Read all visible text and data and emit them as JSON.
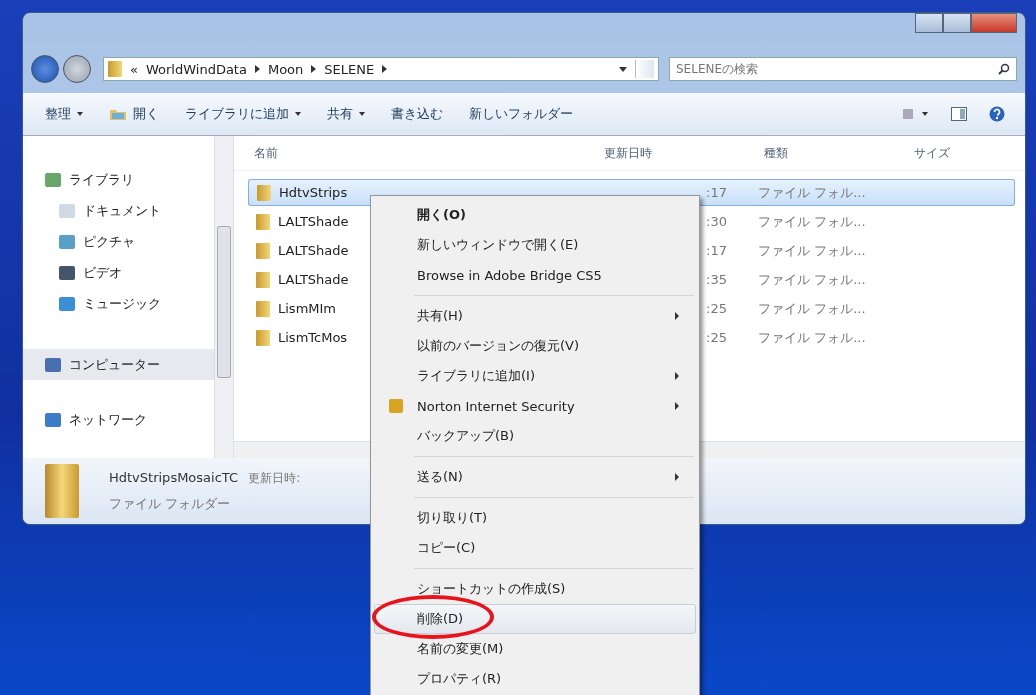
{
  "address": {
    "overflow": "«",
    "crumbs": [
      "WorldWindData",
      "Moon",
      "SELENE"
    ]
  },
  "search": {
    "placeholder": "SELENEの検索"
  },
  "toolbar": [
    {
      "label": "整理",
      "kind": "dropdown"
    },
    {
      "label": "開く",
      "kind": "icon"
    },
    {
      "label": "ライブラリに追加",
      "kind": "dropdown"
    },
    {
      "label": "共有",
      "kind": "dropdown"
    },
    {
      "label": "書き込む",
      "kind": "plain"
    },
    {
      "label": "新しいフォルダー",
      "kind": "plain"
    }
  ],
  "nav": [
    {
      "label": "ライブラリ",
      "kind": "library",
      "selected": false,
      "children": [
        {
          "label": "ドキュメント",
          "kind": "documents",
          "selected": false
        },
        {
          "label": "ピクチャ",
          "kind": "pictures",
          "selected": false
        },
        {
          "label": "ビデオ",
          "kind": "videos",
          "selected": false
        },
        {
          "label": "ミュージック",
          "kind": "music",
          "selected": false
        }
      ]
    },
    {
      "label": "コンピューター",
      "kind": "computer",
      "selected": true
    },
    {
      "label": "ネットワーク",
      "kind": "network",
      "selected": false
    }
  ],
  "columns": [
    "名前",
    "更新日時",
    "種類",
    "サイズ"
  ],
  "rows": [
    {
      "name": "HdtvStrips",
      "date": ":17",
      "type": "ファイル フォル...",
      "selected": true
    },
    {
      "name": "LALTShade",
      "date": ":30",
      "type": "ファイル フォル...",
      "selected": false
    },
    {
      "name": "LALTShade",
      "date": ":17",
      "type": "ファイル フォル...",
      "selected": false
    },
    {
      "name": "LALTShade",
      "date": ":35",
      "type": "ファイル フォル...",
      "selected": false
    },
    {
      "name": "LismMIm",
      "date": ":25",
      "type": "ファイル フォル...",
      "selected": false
    },
    {
      "name": "LismTcMos",
      "date": ":25",
      "type": "ファイル フォル...",
      "selected": false
    }
  ],
  "details": {
    "name": "HdtvStripsMosaicTC",
    "meta": "更新日時:",
    "type": "ファイル フォルダー"
  },
  "context_menu": [
    {
      "kind": "item",
      "label": "開く(O)",
      "default": true,
      "submenu": false,
      "icon": false,
      "selected": false
    },
    {
      "kind": "item",
      "label": "新しいウィンドウで開く(E)",
      "default": false,
      "submenu": false,
      "icon": false,
      "selected": false
    },
    {
      "kind": "item",
      "label": "Browse in Adobe Bridge CS5",
      "default": false,
      "submenu": false,
      "icon": false,
      "selected": false
    },
    {
      "kind": "separator"
    },
    {
      "kind": "item",
      "label": "共有(H)",
      "default": false,
      "submenu": true,
      "icon": false,
      "selected": false
    },
    {
      "kind": "item",
      "label": "以前のバージョンの復元(V)",
      "default": false,
      "submenu": false,
      "icon": false,
      "selected": false
    },
    {
      "kind": "item",
      "label": "ライブラリに追加(I)",
      "default": false,
      "submenu": true,
      "icon": false,
      "selected": false
    },
    {
      "kind": "item",
      "label": "Norton Internet Security",
      "default": false,
      "submenu": true,
      "icon": true,
      "selected": false
    },
    {
      "kind": "item",
      "label": "バックアップ(B)",
      "default": false,
      "submenu": false,
      "icon": false,
      "selected": false
    },
    {
      "kind": "separator"
    },
    {
      "kind": "item",
      "label": "送る(N)",
      "default": false,
      "submenu": true,
      "icon": false,
      "selected": false
    },
    {
      "kind": "separator"
    },
    {
      "kind": "item",
      "label": "切り取り(T)",
      "default": false,
      "submenu": false,
      "icon": false,
      "selected": false
    },
    {
      "kind": "item",
      "label": "コピー(C)",
      "default": false,
      "submenu": false,
      "icon": false,
      "selected": false
    },
    {
      "kind": "separator"
    },
    {
      "kind": "item",
      "label": "ショートカットの作成(S)",
      "default": false,
      "submenu": false,
      "icon": false,
      "selected": false
    },
    {
      "kind": "item",
      "label": "削除(D)",
      "default": false,
      "submenu": false,
      "icon": false,
      "selected": true
    },
    {
      "kind": "item",
      "label": "名前の変更(M)",
      "default": false,
      "submenu": false,
      "icon": false,
      "selected": false
    },
    {
      "kind": "item",
      "label": "プロパティ(R)",
      "default": false,
      "submenu": false,
      "icon": false,
      "selected": false
    }
  ]
}
